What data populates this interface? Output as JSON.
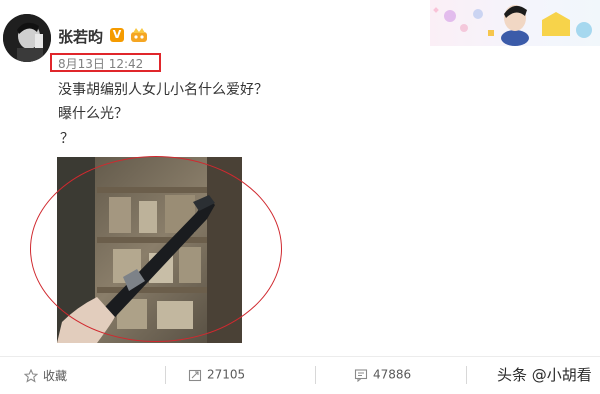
{
  "post": {
    "username": "张若昀",
    "verified_badge": "V",
    "timestamp": "8月13日 12:42",
    "lines": [
      "没事胡编别人女儿小名什么爱好？",
      "曝什么光？",
      "？"
    ]
  },
  "actions": {
    "favorite_label": "收藏",
    "repost_count": "27105",
    "comment_count": "47886"
  },
  "watermark": "头条 @小胡看",
  "colors": {
    "highlight_red": "#e0262b",
    "verified_orange": "#f59b00"
  },
  "icons": [
    "star-icon",
    "repost-icon",
    "comment-icon",
    "like-icon",
    "crown-icon"
  ]
}
